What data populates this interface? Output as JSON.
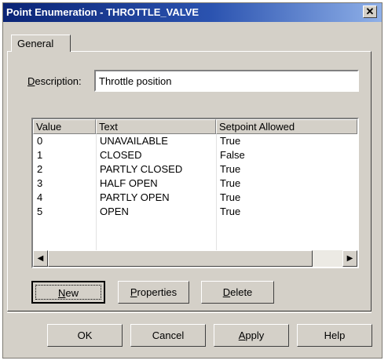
{
  "window": {
    "title": "Point Enumeration - THROTTLE_VALVE",
    "close_glyph": "✕"
  },
  "tabs": [
    {
      "label": "General",
      "active": true
    }
  ],
  "description": {
    "label": "Description:",
    "value": "Throttle position"
  },
  "table": {
    "columns": [
      "Value",
      "Text",
      "Setpoint Allowed"
    ],
    "rows": [
      {
        "value": "0",
        "text": "UNAVAILABLE",
        "setpoint": "True"
      },
      {
        "value": "1",
        "text": "CLOSED",
        "setpoint": "False"
      },
      {
        "value": "2",
        "text": "PARTLY CLOSED",
        "setpoint": "True"
      },
      {
        "value": "3",
        "text": "HALF OPEN",
        "setpoint": "True"
      },
      {
        "value": "4",
        "text": "PARTLY OPEN",
        "setpoint": "True"
      },
      {
        "value": "5",
        "text": "OPEN",
        "setpoint": "True"
      }
    ]
  },
  "scrollbar": {
    "left_glyph": "◀",
    "right_glyph": "▶"
  },
  "buttons": {
    "new": "New",
    "properties": "Properties",
    "delete": "Delete",
    "ok": "OK",
    "cancel": "Cancel",
    "apply": "Apply",
    "help": "Help"
  },
  "colors": {
    "titlebar_start": "#0a2476",
    "titlebar_end": "#8fb0e8",
    "face": "#d4d0c8"
  }
}
